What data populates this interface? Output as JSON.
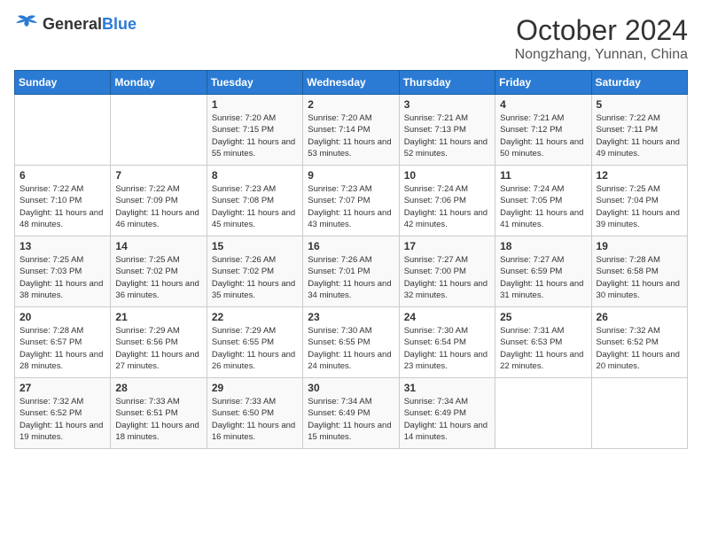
{
  "logo": {
    "general": "General",
    "blue": "Blue"
  },
  "header": {
    "month": "October 2024",
    "location": "Nongzhang, Yunnan, China"
  },
  "weekdays": [
    "Sunday",
    "Monday",
    "Tuesday",
    "Wednesday",
    "Thursday",
    "Friday",
    "Saturday"
  ],
  "weeks": [
    [
      {
        "day": "",
        "detail": ""
      },
      {
        "day": "",
        "detail": ""
      },
      {
        "day": "1",
        "detail": "Sunrise: 7:20 AM\nSunset: 7:15 PM\nDaylight: 11 hours and 55 minutes."
      },
      {
        "day": "2",
        "detail": "Sunrise: 7:20 AM\nSunset: 7:14 PM\nDaylight: 11 hours and 53 minutes."
      },
      {
        "day": "3",
        "detail": "Sunrise: 7:21 AM\nSunset: 7:13 PM\nDaylight: 11 hours and 52 minutes."
      },
      {
        "day": "4",
        "detail": "Sunrise: 7:21 AM\nSunset: 7:12 PM\nDaylight: 11 hours and 50 minutes."
      },
      {
        "day": "5",
        "detail": "Sunrise: 7:22 AM\nSunset: 7:11 PM\nDaylight: 11 hours and 49 minutes."
      }
    ],
    [
      {
        "day": "6",
        "detail": "Sunrise: 7:22 AM\nSunset: 7:10 PM\nDaylight: 11 hours and 48 minutes."
      },
      {
        "day": "7",
        "detail": "Sunrise: 7:22 AM\nSunset: 7:09 PM\nDaylight: 11 hours and 46 minutes."
      },
      {
        "day": "8",
        "detail": "Sunrise: 7:23 AM\nSunset: 7:08 PM\nDaylight: 11 hours and 45 minutes."
      },
      {
        "day": "9",
        "detail": "Sunrise: 7:23 AM\nSunset: 7:07 PM\nDaylight: 11 hours and 43 minutes."
      },
      {
        "day": "10",
        "detail": "Sunrise: 7:24 AM\nSunset: 7:06 PM\nDaylight: 11 hours and 42 minutes."
      },
      {
        "day": "11",
        "detail": "Sunrise: 7:24 AM\nSunset: 7:05 PM\nDaylight: 11 hours and 41 minutes."
      },
      {
        "day": "12",
        "detail": "Sunrise: 7:25 AM\nSunset: 7:04 PM\nDaylight: 11 hours and 39 minutes."
      }
    ],
    [
      {
        "day": "13",
        "detail": "Sunrise: 7:25 AM\nSunset: 7:03 PM\nDaylight: 11 hours and 38 minutes."
      },
      {
        "day": "14",
        "detail": "Sunrise: 7:25 AM\nSunset: 7:02 PM\nDaylight: 11 hours and 36 minutes."
      },
      {
        "day": "15",
        "detail": "Sunrise: 7:26 AM\nSunset: 7:02 PM\nDaylight: 11 hours and 35 minutes."
      },
      {
        "day": "16",
        "detail": "Sunrise: 7:26 AM\nSunset: 7:01 PM\nDaylight: 11 hours and 34 minutes."
      },
      {
        "day": "17",
        "detail": "Sunrise: 7:27 AM\nSunset: 7:00 PM\nDaylight: 11 hours and 32 minutes."
      },
      {
        "day": "18",
        "detail": "Sunrise: 7:27 AM\nSunset: 6:59 PM\nDaylight: 11 hours and 31 minutes."
      },
      {
        "day": "19",
        "detail": "Sunrise: 7:28 AM\nSunset: 6:58 PM\nDaylight: 11 hours and 30 minutes."
      }
    ],
    [
      {
        "day": "20",
        "detail": "Sunrise: 7:28 AM\nSunset: 6:57 PM\nDaylight: 11 hours and 28 minutes."
      },
      {
        "day": "21",
        "detail": "Sunrise: 7:29 AM\nSunset: 6:56 PM\nDaylight: 11 hours and 27 minutes."
      },
      {
        "day": "22",
        "detail": "Sunrise: 7:29 AM\nSunset: 6:55 PM\nDaylight: 11 hours and 26 minutes."
      },
      {
        "day": "23",
        "detail": "Sunrise: 7:30 AM\nSunset: 6:55 PM\nDaylight: 11 hours and 24 minutes."
      },
      {
        "day": "24",
        "detail": "Sunrise: 7:30 AM\nSunset: 6:54 PM\nDaylight: 11 hours and 23 minutes."
      },
      {
        "day": "25",
        "detail": "Sunrise: 7:31 AM\nSunset: 6:53 PM\nDaylight: 11 hours and 22 minutes."
      },
      {
        "day": "26",
        "detail": "Sunrise: 7:32 AM\nSunset: 6:52 PM\nDaylight: 11 hours and 20 minutes."
      }
    ],
    [
      {
        "day": "27",
        "detail": "Sunrise: 7:32 AM\nSunset: 6:52 PM\nDaylight: 11 hours and 19 minutes."
      },
      {
        "day": "28",
        "detail": "Sunrise: 7:33 AM\nSunset: 6:51 PM\nDaylight: 11 hours and 18 minutes."
      },
      {
        "day": "29",
        "detail": "Sunrise: 7:33 AM\nSunset: 6:50 PM\nDaylight: 11 hours and 16 minutes."
      },
      {
        "day": "30",
        "detail": "Sunrise: 7:34 AM\nSunset: 6:49 PM\nDaylight: 11 hours and 15 minutes."
      },
      {
        "day": "31",
        "detail": "Sunrise: 7:34 AM\nSunset: 6:49 PM\nDaylight: 11 hours and 14 minutes."
      },
      {
        "day": "",
        "detail": ""
      },
      {
        "day": "",
        "detail": ""
      }
    ]
  ]
}
